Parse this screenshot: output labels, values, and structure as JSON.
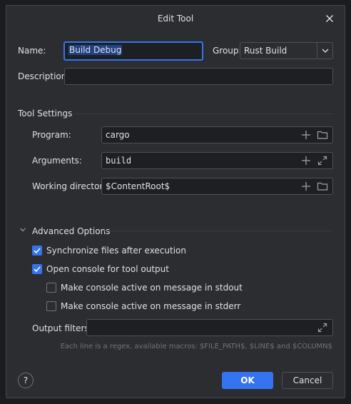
{
  "dialog": {
    "title": "Edit Tool"
  },
  "form": {
    "name_label": "Name:",
    "name_value": "Build Debug",
    "group_label": "Group:",
    "group_value": "Rust Build",
    "description_label": "Description:",
    "description_value": ""
  },
  "tool_settings": {
    "header": "Tool Settings",
    "program_label": "Program:",
    "program_value": "cargo",
    "arguments_label": "Arguments:",
    "arguments_value": "build",
    "working_dir_label": "Working directory:",
    "working_dir_value": "$ContentRoot$"
  },
  "advanced": {
    "header": "Advanced Options",
    "sync_files": {
      "label": "Synchronize files after execution",
      "checked": true
    },
    "open_console": {
      "label": "Open console for tool output",
      "checked": true
    },
    "active_stdout": {
      "label": "Make console active on message in stdout",
      "checked": false
    },
    "active_stderr": {
      "label": "Make console active on message in stderr",
      "checked": false
    },
    "output_filters_label": "Output filters:",
    "output_filters_value": "",
    "hint": "Each line is a regex, available macros: $FILE_PATH$, $LINE$ and $COLUMN$"
  },
  "footer": {
    "help_label": "?",
    "ok_label": "OK",
    "cancel_label": "Cancel"
  },
  "colors": {
    "accent": "#3574f0",
    "background": "#2b2d30",
    "field_background": "#1e1f22",
    "border": "#4e5157",
    "text": "#dfe1e5",
    "hint_text": "#6f737a"
  },
  "icons": [
    "close-icon",
    "chevron-down-icon",
    "plus-icon",
    "folder-icon",
    "expand-icon",
    "checkmark-icon"
  ]
}
